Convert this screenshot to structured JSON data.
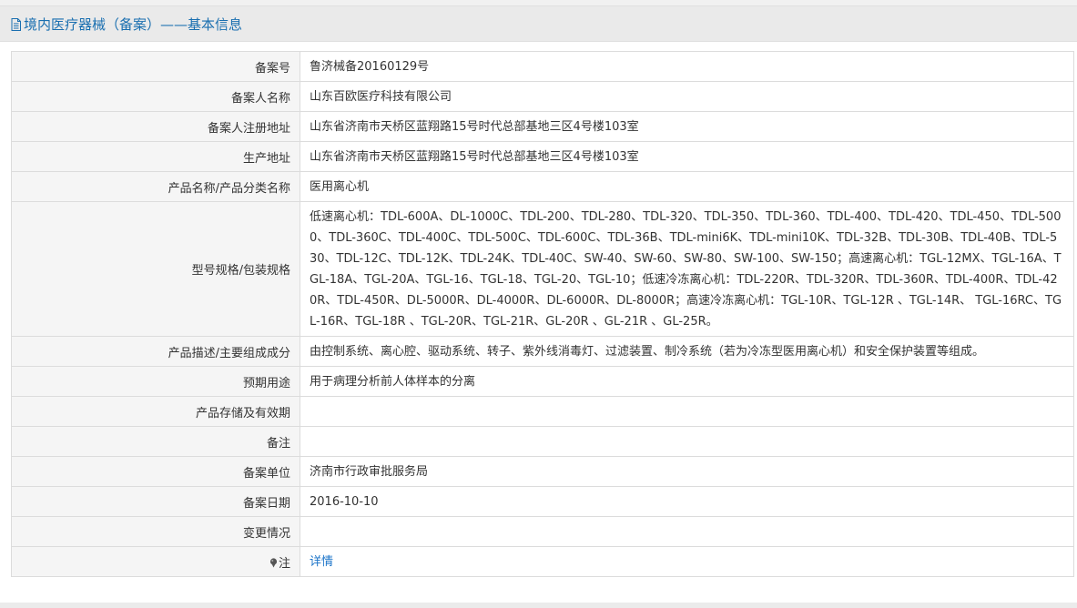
{
  "header": {
    "title": "境内医疗器械（备案）——基本信息"
  },
  "rows": [
    {
      "label": "备案号",
      "value": "鲁济械备20160129号"
    },
    {
      "label": "备案人名称",
      "value": "山东百欧医疗科技有限公司"
    },
    {
      "label": "备案人注册地址",
      "value": "山东省济南市天桥区蓝翔路15号时代总部基地三区4号楼103室"
    },
    {
      "label": "生产地址",
      "value": "山东省济南市天桥区蓝翔路15号时代总部基地三区4号楼103室"
    },
    {
      "label": "产品名称/产品分类名称",
      "value": "医用离心机"
    },
    {
      "label": "型号规格/包装规格",
      "value": "低速离心机：TDL-600A、DL-1000C、TDL-200、TDL-280、TDL-320、TDL-350、TDL-360、TDL-400、TDL-420、TDL-450、TDL-5000、TDL-360C、TDL-400C、TDL-500C、TDL-600C、TDL-36B、TDL-mini6K、TDL-mini10K、TDL-32B、TDL-30B、TDL-40B、TDL-530、TDL-12C、TDL-12K、TDL-24K、TDL-40C、SW-40、SW-60、SW-80、SW-100、SW-150；高速离心机：TGL-12MX、TGL-16A、TGL-18A、TGL-20A、TGL-16、TGL-18、TGL-20、TGL-10；低速冷冻离心机：TDL-220R、TDL-320R、TDL-360R、TDL-400R、TDL-420R、TDL-450R、DL-5000R、DL-4000R、DL-6000R、DL-8000R；高速冷冻离心机：TGL-10R、TGL-12R 、TGL-14R、 TGL-16RC、TGL-16R、TGL-18R 、TGL-20R、TGL-21R、GL-20R 、GL-21R 、GL-25R。"
    },
    {
      "label": "产品描述/主要组成成分",
      "value": "由控制系统、离心腔、驱动系统、转子、紫外线消毒灯、过滤装置、制冷系统（若为冷冻型医用离心机）和安全保护装置等组成。"
    },
    {
      "label": "预期用途",
      "value": "用于病理分析前人体样本的分离"
    },
    {
      "label": "产品存储及有效期",
      "value": ""
    },
    {
      "label": "备注",
      "value": ""
    },
    {
      "label": "备案单位",
      "value": "济南市行政审批服务局"
    },
    {
      "label": "备案日期",
      "value": "2016-10-10"
    },
    {
      "label": "变更情况",
      "value": ""
    }
  ],
  "note_row": {
    "label": "注",
    "link": "详情"
  }
}
